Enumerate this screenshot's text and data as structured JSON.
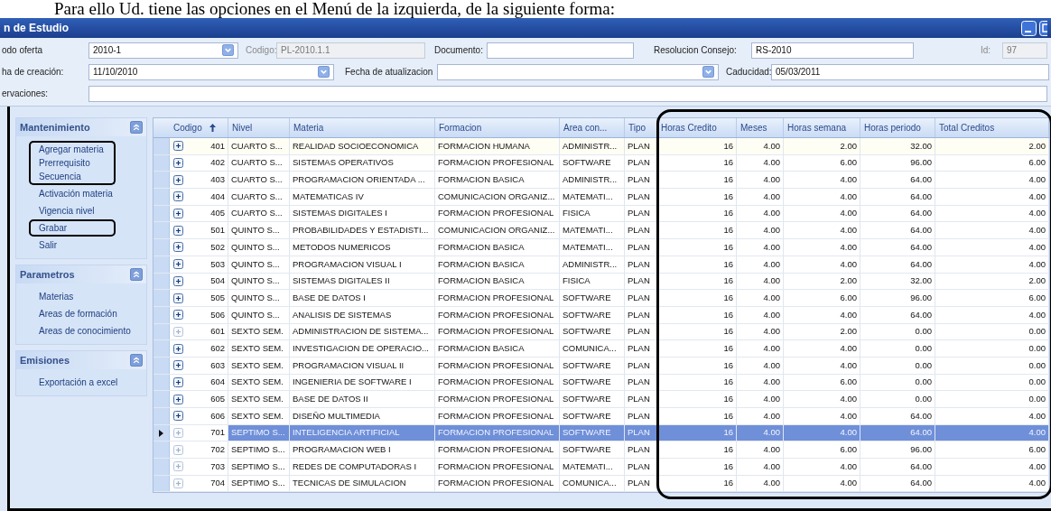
{
  "caption": "Para ello Ud. tiene las opciones en el Menú de la izquierda, de la siguiente forma:",
  "window": {
    "title": "n de Estudio"
  },
  "form": {
    "lines": [
      {
        "fields": [
          {
            "label": "odo oferta",
            "kind": "select",
            "value": "2010-1",
            "disabled": false
          },
          {
            "label": "Codigo:",
            "kind": "text",
            "value": "PL-2010.1.1",
            "disabled": true
          },
          {
            "label": "Documento:",
            "kind": "text",
            "disabled": false
          },
          {
            "label": "Resolucion Consejo:",
            "kind": "text",
            "value": "RS-2010",
            "disabled": false
          },
          {
            "label": "Id:",
            "kind": "text",
            "value": "97",
            "disabled": true
          }
        ]
      },
      {
        "fields": [
          {
            "label": "ha de creación:",
            "kind": "select",
            "value": "11/10/2010",
            "disabled": false
          },
          {
            "label": "Fecha de atualizacion",
            "kind": "select",
            "disabled": false
          },
          {
            "label": "Caducidad:",
            "kind": "text",
            "value": "05/03/2011",
            "disabled": false
          }
        ]
      },
      {
        "fields": [
          {
            "label": "ervaciones:",
            "kind": "text",
            "disabled": false
          }
        ]
      }
    ]
  },
  "sidebar": [
    {
      "title": "Mantenimiento",
      "items": [
        {
          "label": "Agregar materia",
          "framed": true
        },
        {
          "label": "Prerrequisito",
          "framed": true
        },
        {
          "label": "Secuencia",
          "framed": true
        },
        {
          "label": "Activación materia",
          "framed": false
        },
        {
          "label": "Vigencia nivel",
          "framed": false
        },
        {
          "label": "Grabar",
          "framed": true
        },
        {
          "label": "Salir",
          "framed": false
        }
      ]
    },
    {
      "title": "Parametros",
      "items": [
        {
          "label": "Materias",
          "framed": false
        },
        {
          "label": "Areas de formación",
          "framed": false
        },
        {
          "label": "Areas de conocimiento",
          "framed": false
        }
      ]
    },
    {
      "title": "Emisiones",
      "items": [
        {
          "label": "Exportación a excel",
          "framed": false
        }
      ]
    }
  ],
  "table": {
    "columns": [
      {
        "label": "Codigo",
        "sorted": true
      },
      {
        "label": "Nivel"
      },
      {
        "label": "Materia"
      },
      {
        "label": "Formacion"
      },
      {
        "label": "Area con..."
      },
      {
        "label": "Tipo"
      },
      {
        "label": "Horas Credito"
      },
      {
        "label": "Meses"
      },
      {
        "label": "Horas semana"
      },
      {
        "label": "Horas periodo"
      },
      {
        "label": "Total Creditos"
      }
    ],
    "rows": [
      {
        "cells": [
          "401",
          "CUARTO S...",
          "REALIDAD SOCIOECONOMICA",
          "FORMACION HUMANA",
          "ADMINISTR...",
          "PLAN",
          "16",
          "4.00",
          "2.00",
          "32.00",
          "2.00"
        ],
        "expandable": true,
        "selected": false
      },
      {
        "cells": [
          "402",
          "CUARTO S...",
          "SISTEMAS OPERATIVOS",
          "FORMACION PROFESIONAL",
          "SOFTWARE",
          "PLAN",
          "16",
          "4.00",
          "6.00",
          "96.00",
          "6.00"
        ],
        "expandable": true,
        "selected": false
      },
      {
        "cells": [
          "403",
          "CUARTO S...",
          "PROGRAMACION ORIENTADA ...",
          "FORMACION BASICA",
          "ADMINISTR...",
          "PLAN",
          "16",
          "4.00",
          "4.00",
          "64.00",
          "4.00"
        ],
        "expandable": true,
        "selected": false
      },
      {
        "cells": [
          "404",
          "CUARTO S...",
          "MATEMATICAS IV",
          "COMUNICACION ORGANIZ...",
          "MATEMATI...",
          "PLAN",
          "16",
          "4.00",
          "4.00",
          "64.00",
          "4.00"
        ],
        "expandable": true,
        "selected": false
      },
      {
        "cells": [
          "405",
          "CUARTO S...",
          "SISTEMAS DIGITALES I",
          "FORMACION PROFESIONAL",
          "FISICA",
          "PLAN",
          "16",
          "4.00",
          "4.00",
          "64.00",
          "4.00"
        ],
        "expandable": true,
        "selected": false
      },
      {
        "cells": [
          "501",
          "QUINTO S...",
          "PROBABILIDADES Y ESTADISTI...",
          "COMUNICACION ORGANIZ...",
          "MATEMATI...",
          "PLAN",
          "16",
          "4.00",
          "4.00",
          "64.00",
          "4.00"
        ],
        "expandable": true,
        "selected": false
      },
      {
        "cells": [
          "502",
          "QUINTO S...",
          "METODOS NUMERICOS",
          "FORMACION BASICA",
          "MATEMATI...",
          "PLAN",
          "16",
          "4.00",
          "4.00",
          "64.00",
          "4.00"
        ],
        "expandable": true,
        "selected": false
      },
      {
        "cells": [
          "503",
          "QUINTO S...",
          "PROGRAMACION VISUAL I",
          "FORMACION BASICA",
          "ADMINISTR...",
          "PLAN",
          "16",
          "4.00",
          "4.00",
          "64.00",
          "4.00"
        ],
        "expandable": true,
        "selected": false
      },
      {
        "cells": [
          "504",
          "QUINTO S...",
          "SISTEMAS DIGITALES II",
          "FORMACION BASICA",
          "FISICA",
          "PLAN",
          "16",
          "4.00",
          "2.00",
          "32.00",
          "2.00"
        ],
        "expandable": true,
        "selected": false
      },
      {
        "cells": [
          "505",
          "QUINTO S...",
          "BASE DE DATOS I",
          "FORMACION PROFESIONAL",
          "SOFTWARE",
          "PLAN",
          "16",
          "4.00",
          "6.00",
          "96.00",
          "6.00"
        ],
        "expandable": true,
        "selected": false
      },
      {
        "cells": [
          "506",
          "QUINTO S...",
          "ANALISIS DE SISTEMAS",
          "FORMACION PROFESIONAL",
          "SOFTWARE",
          "PLAN",
          "16",
          "4.00",
          "4.00",
          "64.00",
          "4.00"
        ],
        "expandable": true,
        "selected": false
      },
      {
        "cells": [
          "601",
          "SEXTO SEM.",
          "ADMINISTRACION DE SISTEMA...",
          "FORMACION PROFESIONAL",
          "SOFTWARE",
          "PLAN",
          "16",
          "4.00",
          "2.00",
          "0.00",
          "0.00"
        ],
        "expandable": false,
        "selected": false
      },
      {
        "cells": [
          "602",
          "SEXTO SEM.",
          "INVESTIGACION DE OPERACIO...",
          "FORMACION BASICA",
          "COMUNICA...",
          "PLAN",
          "16",
          "4.00",
          "4.00",
          "0.00",
          "0.00"
        ],
        "expandable": true,
        "selected": false
      },
      {
        "cells": [
          "603",
          "SEXTO SEM.",
          "PROGRAMACION VISUAL II",
          "FORMACION PROFESIONAL",
          "SOFTWARE",
          "PLAN",
          "16",
          "4.00",
          "4.00",
          "0.00",
          "0.00"
        ],
        "expandable": true,
        "selected": false
      },
      {
        "cells": [
          "604",
          "SEXTO SEM.",
          "INGENIERIA DE SOFTWARE I",
          "FORMACION PROFESIONAL",
          "SOFTWARE",
          "PLAN",
          "16",
          "4.00",
          "6.00",
          "0.00",
          "0.00"
        ],
        "expandable": true,
        "selected": false
      },
      {
        "cells": [
          "605",
          "SEXTO SEM.",
          "BASE DE DATOS II",
          "FORMACION PROFESIONAL",
          "SOFTWARE",
          "PLAN",
          "16",
          "4.00",
          "4.00",
          "0.00",
          "0.00"
        ],
        "expandable": true,
        "selected": false
      },
      {
        "cells": [
          "606",
          "SEXTO SEM.",
          "DISEÑO MULTIMEDIA",
          "FORMACION PROFESIONAL",
          "SOFTWARE",
          "PLAN",
          "16",
          "4.00",
          "4.00",
          "64.00",
          "4.00"
        ],
        "expandable": true,
        "selected": false
      },
      {
        "cells": [
          "701",
          "SEPTIMO S...",
          "INTELIGENCIA ARTIFICIAL",
          "FORMACION PROFESIONAL",
          "SOFTWARE",
          "PLAN",
          "16",
          "4.00",
          "4.00",
          "64.00",
          "4.00"
        ],
        "expandable": false,
        "selected": true
      },
      {
        "cells": [
          "702",
          "SEPTIMO S...",
          "PROGRAMACION WEB I",
          "FORMACION PROFESIONAL",
          "SOFTWARE",
          "PLAN",
          "16",
          "4.00",
          "6.00",
          "96.00",
          "6.00"
        ],
        "expandable": false,
        "selected": false
      },
      {
        "cells": [
          "703",
          "SEPTIMO S...",
          "REDES DE COMPUTADORAS I",
          "FORMACION PROFESIONAL",
          "MATEMATI...",
          "PLAN",
          "16",
          "4.00",
          "4.00",
          "64.00",
          "4.00"
        ],
        "expandable": false,
        "selected": false
      },
      {
        "cells": [
          "704",
          "SEPTIMO S...",
          "TECNICAS DE SIMULACION",
          "FORMACION PROFESIONAL",
          "COMUNICA...",
          "PLAN",
          "16",
          "4.00",
          "4.00",
          "64.00",
          "4.00"
        ],
        "expandable": false,
        "selected": false
      }
    ]
  }
}
